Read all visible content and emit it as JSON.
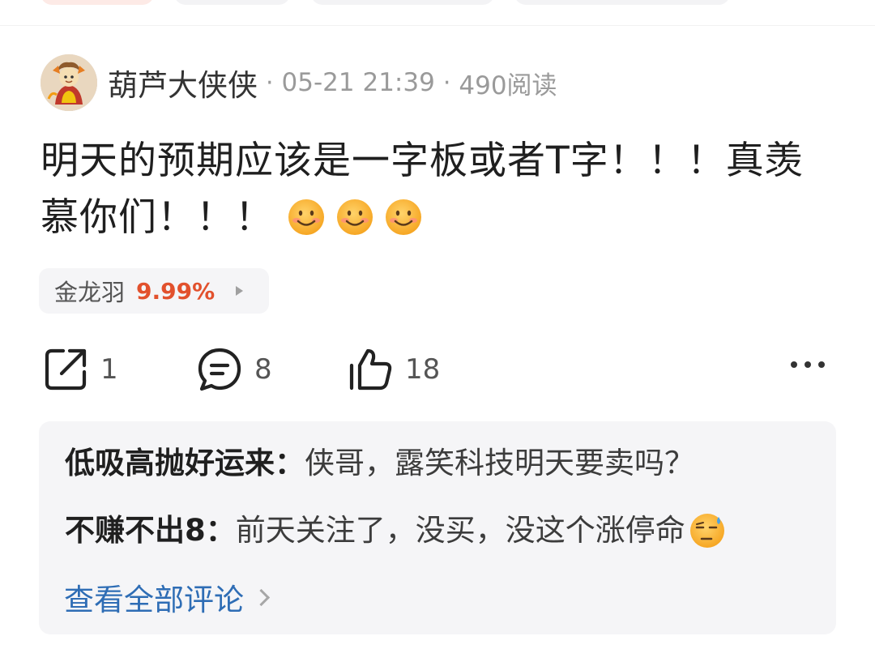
{
  "post": {
    "username": "葫芦大侠侠",
    "separator": "·",
    "time": "05-21 21:39",
    "reads": "490阅读",
    "text": "明天的预期应该是一字板或者T字！！！真羡慕你们！！！",
    "emojis": [
      "smile-emoji",
      "smile-emoji",
      "smile-emoji"
    ]
  },
  "stock_tag": {
    "name": "金龙羽",
    "change": "9.99%",
    "change_color": "#e2512d"
  },
  "actions": {
    "share_count": "1",
    "comment_count": "8",
    "like_count": "18",
    "icons": [
      "share-icon",
      "comment-icon",
      "like-icon",
      "more-icon"
    ]
  },
  "comments": [
    {
      "author": "低吸高抛好运来：",
      "text": "侠哥，露笑科技明天要卖吗？"
    },
    {
      "author": "不赚不出8：",
      "text": "前天关注了，没买，没这个涨停命",
      "emoji": "sweat-emoji"
    }
  ],
  "view_all_label": "查看全部评论",
  "colors": {
    "accent_blue": "#2e6db5",
    "stock_red": "#e2512d",
    "card_bg": "#f5f5f7"
  }
}
